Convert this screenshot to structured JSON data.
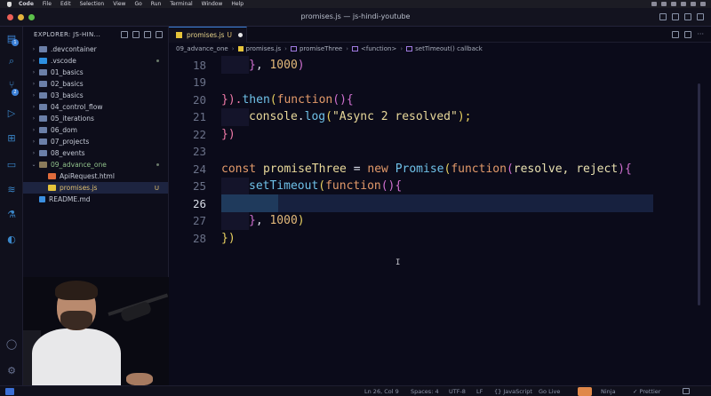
{
  "menubar": {
    "items": [
      "Code",
      "File",
      "Edit",
      "Selection",
      "View",
      "Go",
      "Run",
      "Terminal",
      "Window",
      "Help"
    ]
  },
  "window": {
    "title": "promises.js — js-hindi-youtube"
  },
  "activity_bar": {
    "badges": [
      "1",
      "2"
    ],
    "icons": [
      "files-icon",
      "search-icon",
      "source-control-icon",
      "run-debug-icon",
      "extensions-icon",
      "remote-icon",
      "docker-icon",
      "testing-icon",
      "live-share-icon",
      "account-icon",
      "settings-gear-icon"
    ]
  },
  "explorer": {
    "header": "EXPLORER: JS-HIN...",
    "tree": [
      {
        "label": ".devcontainer",
        "type": "folder"
      },
      {
        "label": ".vscode",
        "type": "folder-vscode",
        "dot": true
      },
      {
        "label": "01_basics",
        "type": "folder"
      },
      {
        "label": "02_basics",
        "type": "folder"
      },
      {
        "label": "03_basics",
        "type": "folder"
      },
      {
        "label": "04_control_flow",
        "type": "folder"
      },
      {
        "label": "05_iterations",
        "type": "folder"
      },
      {
        "label": "06_dom",
        "type": "folder"
      },
      {
        "label": "07_projects",
        "type": "folder"
      },
      {
        "label": "08_events",
        "type": "folder"
      },
      {
        "label": "09_advance_one",
        "type": "folder-open",
        "dot": true
      },
      {
        "label": "ApiRequest.html",
        "type": "html"
      },
      {
        "label": "promises.js",
        "type": "js",
        "status": "U"
      },
      {
        "label": "README.md",
        "type": "info"
      }
    ]
  },
  "tab": {
    "label": "promises.js",
    "status": "U"
  },
  "breadcrumb": [
    "09_advance_one",
    "promises.js",
    "promiseThree",
    "<function>",
    "setTimeout() callback"
  ],
  "editor": {
    "line_numbers": [
      "18",
      "19",
      "20",
      "21",
      "22",
      "23",
      "24",
      "25",
      "26",
      "27",
      "28"
    ],
    "current_line": "26",
    "lines": {
      "l18_a": "}",
      "l18_b": ", ",
      "l18_c": "1000",
      "l18_d": ")",
      "l20_a": "}",
      "l20_b": ").",
      "l20_c": "then",
      "l20_d": "(",
      "l20_e": "function",
      "l20_f": "(){",
      "l21_a": "console",
      "l21_b": ".",
      "l21_c": "log",
      "l21_d": "(",
      "l21_e": "\"Async 2 resolved\"",
      "l21_f": ");",
      "l22_a": "})",
      "l24_a": "const ",
      "l24_b": "promiseThree",
      "l24_c": " = ",
      "l24_d": "new ",
      "l24_e": "Promise",
      "l24_f": "(",
      "l24_g": "function",
      "l24_h": "(",
      "l24_i": "resolve, reject",
      "l24_j": "){",
      "l25_a": "setTimeout",
      "l25_b": "(",
      "l25_c": "function",
      "l25_d": "(){",
      "l27_a": "}",
      "l27_b": ", ",
      "l27_c": "1000",
      "l27_d": ")",
      "l28_a": "})"
    }
  },
  "statusbar": {
    "position": "Ln 26, Col 9",
    "spaces": "Spaces: 4",
    "encoding": "UTF-8",
    "eol": "LF",
    "language": "{} JavaScript",
    "golive": "Go Live",
    "ninja": "Ninja",
    "prettier": "✓ Prettier"
  },
  "colors": {
    "accent": "#3b7fd6",
    "background": "#0b0b1a",
    "cursorline": "#17213f"
  }
}
